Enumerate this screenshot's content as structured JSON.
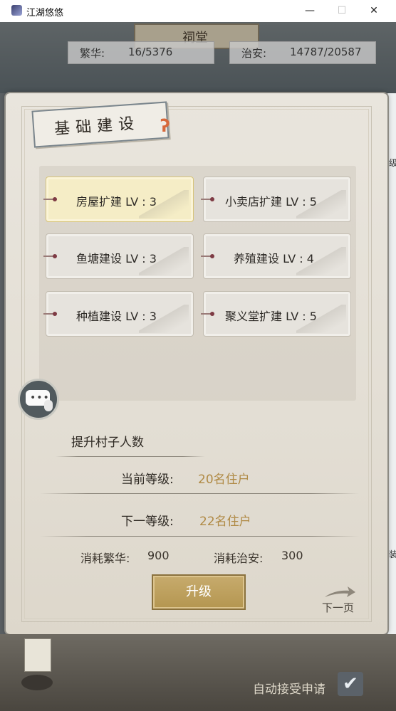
{
  "window": {
    "title": "江湖悠悠",
    "min_symbol": "—",
    "max_symbol": "☐",
    "close_symbol": "✕"
  },
  "background": {
    "plaque_text": "祠堂"
  },
  "stats": {
    "fanhua_label": "繁华:",
    "fanhua_value": "16/5376",
    "zhian_label": "治安:",
    "zhian_value": "14787/20587"
  },
  "edge_marks": {
    "right_top": "级",
    "right_bottom": "装"
  },
  "panel": {
    "title": "基础建设",
    "ribbon_glyph": "ʔ"
  },
  "buildings": [
    {
      "name": "房屋扩建 LV : 3",
      "selected": true
    },
    {
      "name": "小卖店扩建 LV : 5",
      "selected": false
    },
    {
      "name": "鱼塘建设 LV : 3",
      "selected": false
    },
    {
      "name": "养殖建设 LV : 4",
      "selected": false
    },
    {
      "name": "种植建设 LV : 3",
      "selected": false
    },
    {
      "name": "聚义堂扩建 LV : 5",
      "selected": false
    }
  ],
  "chat": {
    "dots": "•••"
  },
  "detail": {
    "description": "提升村子人数",
    "current_label": "当前等级:",
    "current_value": "20名住户",
    "next_label": "下一等级:",
    "next_value": "22名住户",
    "cost_fanhua_label": "消耗繁华:",
    "cost_fanhua_value": "900",
    "cost_zhian_label": "消耗治安:",
    "cost_zhian_value": "300"
  },
  "buttons": {
    "upgrade": "升级",
    "next_page": "下一页"
  },
  "footer": {
    "auto_accept": "自动接受申请",
    "check_symbol": "✔"
  },
  "colors": {
    "accent_gold": "#b08a45",
    "selected_card": "#f5edc6",
    "button": "#b49650"
  }
}
